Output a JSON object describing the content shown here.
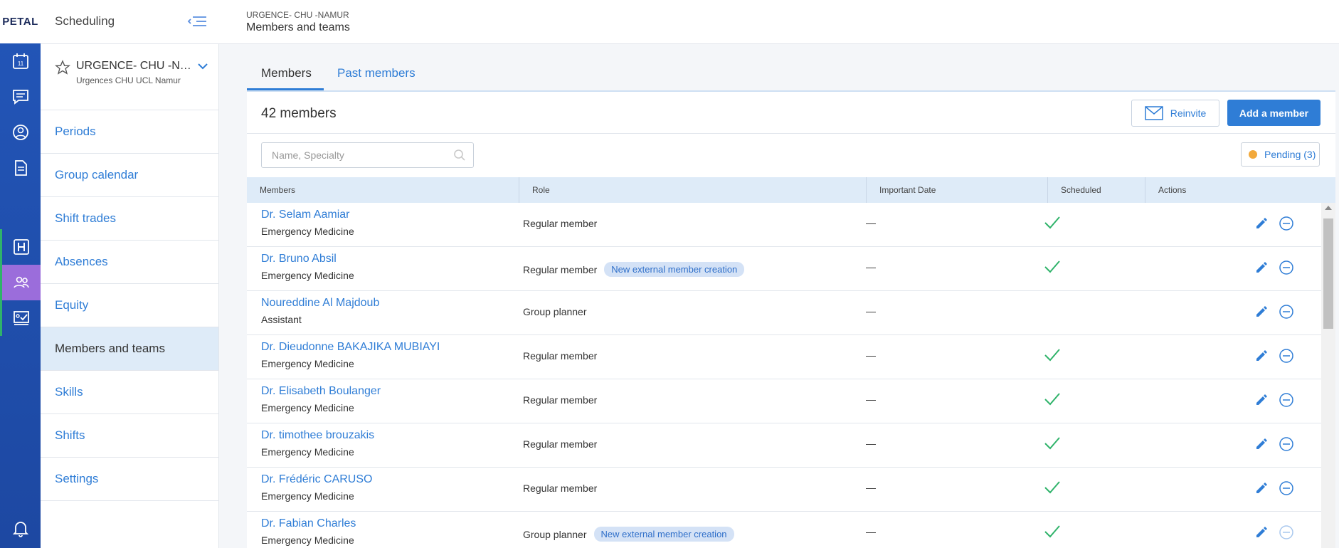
{
  "app": {
    "logo": "PETAL",
    "section": "Scheduling"
  },
  "breadcrumb": {
    "group": "URGENCE- CHU -NAMUR",
    "page": "Members and teams"
  },
  "rail": {
    "calendar_day": "11"
  },
  "group": {
    "name": "URGENCE- CHU -NAMUR",
    "subtitle": "Urgences CHU UCL Namur"
  },
  "nav": [
    {
      "label": "Periods"
    },
    {
      "label": "Group calendar"
    },
    {
      "label": "Shift trades"
    },
    {
      "label": "Absences"
    },
    {
      "label": "Equity"
    },
    {
      "label": "Members and teams"
    },
    {
      "label": "Skills"
    },
    {
      "label": "Shifts"
    },
    {
      "label": "Settings"
    }
  ],
  "tabs": [
    {
      "label": "Members"
    },
    {
      "label": "Past members"
    }
  ],
  "members": {
    "count_label": "42 members",
    "reinvite_label": "Reinvite",
    "add_label": "Add a member",
    "search_placeholder": "Name, Specialty",
    "pending_label": "Pending (3)",
    "columns": [
      "Members",
      "Role",
      "Important Date",
      "Scheduled",
      "Actions"
    ],
    "rows": [
      {
        "name": "Dr. Selam Aamiar",
        "specialty": "Emergency Medicine",
        "role": "Regular member",
        "badge": "",
        "date": "—",
        "scheduled": true
      },
      {
        "name": "Dr. Bruno Absil",
        "specialty": "Emergency Medicine",
        "role": "Regular member",
        "badge": "New external member creation",
        "date": "—",
        "scheduled": true
      },
      {
        "name": "Noureddine Al Majdoub",
        "specialty": "Assistant",
        "role": "Group planner",
        "badge": "",
        "date": "—",
        "scheduled": false
      },
      {
        "name": "Dr. Dieudonne BAKAJIKA MUBIAYI",
        "specialty": "Emergency Medicine",
        "role": "Regular member",
        "badge": "",
        "date": "—",
        "scheduled": true
      },
      {
        "name": "Dr. Elisabeth Boulanger",
        "specialty": "Emergency Medicine",
        "role": "Regular member",
        "badge": "",
        "date": "—",
        "scheduled": true
      },
      {
        "name": "Dr. timothee brouzakis",
        "specialty": "Emergency Medicine",
        "role": "Regular member",
        "badge": "",
        "date": "—",
        "scheduled": true
      },
      {
        "name": "Dr. Frédéric CARUSO",
        "specialty": "Emergency Medicine",
        "role": "Regular member",
        "badge": "",
        "date": "—",
        "scheduled": true
      },
      {
        "name": "Dr. Fabian Charles",
        "specialty": "Emergency Medicine",
        "role": "Group planner",
        "badge": "New external member creation",
        "date": "—",
        "scheduled": true
      }
    ]
  },
  "colors": {
    "accent": "#2f7dd6",
    "rail": "#2356b8",
    "active_rail": "#9b6ddb",
    "check": "#2fb36a",
    "pending_dot": "#f2a93b"
  }
}
